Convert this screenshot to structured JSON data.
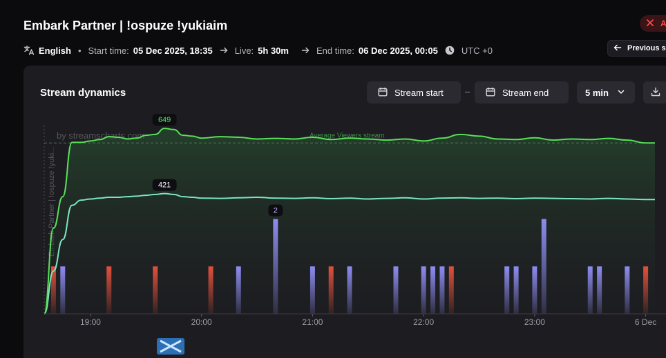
{
  "header": {
    "title": "Embark Partner | !ospuze !yukiaim",
    "live_badge": "A",
    "language": "English",
    "start_label": "Start time:",
    "start_value": "05 Dec 2025, 18:35",
    "live_label": "Live:",
    "live_value": "5h 30m",
    "end_label": "End time:",
    "end_value": "06 Dec 2025, 00:05",
    "timezone": "UTC +0",
    "previous_button": "Previous s"
  },
  "card": {
    "title": "Stream dynamics",
    "stream_start_button": "Stream start",
    "dash": "–",
    "stream_end_button": "Stream end",
    "interval": "5 min"
  },
  "icons": {
    "language": "translate-icon",
    "arrow": "arrow-right-icon",
    "clock": "clock-icon",
    "calendar": "calendar-icon",
    "chevron": "chevron-down-icon",
    "download": "download-icon",
    "back": "arrow-left-icon"
  },
  "colors": {
    "peak_line": "#58e05a",
    "avg_line": "#7be6c0",
    "bar_blue": "#8e8cf2",
    "bar_red": "#e2503c",
    "live_red": "#ff4b4b"
  },
  "chart_data": {
    "type": "line",
    "watermark": "by streamscharts.com",
    "vertical_label": "Embark Partner | !ospuze !yuki...",
    "reference_line_label": "Average Viewers stream",
    "x_ticks": [
      "19:00",
      "20:00",
      "21:00",
      "22:00",
      "23:00",
      "6 Dec"
    ],
    "series": [
      {
        "name": "peak",
        "color": "#58e05a",
        "x": [
          "18:35",
          "18:40",
          "18:45",
          "18:50",
          "18:55",
          "19:00",
          "19:05",
          "19:10",
          "19:15",
          "19:20",
          "19:25",
          "19:30",
          "19:35",
          "19:40",
          "19:45",
          "19:50",
          "19:55",
          "20:00",
          "20:10",
          "20:20",
          "20:30",
          "20:40",
          "20:50",
          "21:00",
          "21:10",
          "21:20",
          "21:30",
          "21:40",
          "21:50",
          "22:00",
          "22:10",
          "22:20",
          "22:30",
          "22:40",
          "22:50",
          "23:00",
          "23:10",
          "23:20",
          "23:30",
          "23:40",
          "23:50",
          "00:00",
          "00:05"
        ],
        "y": [
          0,
          300,
          410,
          600,
          600,
          605,
          610,
          620,
          618,
          612,
          615,
          625,
          628,
          649,
          645,
          625,
          622,
          615,
          620,
          618,
          612,
          614,
          612,
          618,
          610,
          615,
          612,
          608,
          612,
          605,
          615,
          628,
          622,
          612,
          610,
          616,
          608,
          612,
          610,
          614,
          608,
          598,
          598
        ]
      },
      {
        "name": "average",
        "color": "#7be6c0",
        "x": [
          "18:35",
          "18:40",
          "18:45",
          "18:50",
          "18:55",
          "19:00",
          "19:05",
          "19:10",
          "19:15",
          "19:20",
          "19:25",
          "19:30",
          "19:35",
          "19:40",
          "19:45",
          "19:50",
          "19:55",
          "20:00",
          "20:10",
          "20:20",
          "20:30",
          "20:40",
          "20:50",
          "21:00",
          "21:10",
          "21:20",
          "21:30",
          "21:40",
          "21:50",
          "22:00",
          "22:10",
          "22:20",
          "22:30",
          "22:40",
          "22:50",
          "23:00",
          "23:10",
          "23:20",
          "23:30",
          "23:40",
          "23:50",
          "00:00",
          "00:05"
        ],
        "y": [
          0,
          150,
          260,
          380,
          398,
          402,
          405,
          408,
          408,
          410,
          412,
          415,
          418,
          421,
          418,
          410,
          408,
          405,
          404,
          406,
          408,
          405,
          404,
          406,
          403,
          405,
          402,
          404,
          406,
          402,
          405,
          406,
          404,
          405,
          403,
          405,
          404,
          403,
          402,
          404,
          402,
          400,
          400
        ]
      }
    ],
    "labels": [
      {
        "series": "peak",
        "x": "19:40",
        "text": "649"
      },
      {
        "series": "average",
        "x": "19:40",
        "text": "421"
      },
      {
        "series": "events",
        "x": "20:40",
        "text": "2"
      }
    ],
    "reference_value": 598,
    "events": {
      "blue_x": [
        "18:45",
        "20:20",
        "20:40",
        "21:00",
        "21:20",
        "21:45",
        "22:00",
        "22:05",
        "22:10",
        "22:45",
        "22:50",
        "23:00",
        "23:05",
        "23:30",
        "23:35",
        "23:50"
      ],
      "blue_y": [
        1,
        1,
        2,
        1,
        1,
        1,
        1,
        1,
        1,
        1,
        1,
        1,
        2,
        1,
        1,
        1
      ],
      "red_x": [
        "18:40",
        "19:10",
        "19:35",
        "20:05",
        "21:10",
        "22:15",
        "00:00"
      ],
      "red_y": [
        1,
        1,
        1,
        1,
        1,
        1,
        1
      ]
    },
    "ylim": [
      0,
      700
    ],
    "event_ylim": [
      0,
      2.4
    ],
    "grid": false
  }
}
